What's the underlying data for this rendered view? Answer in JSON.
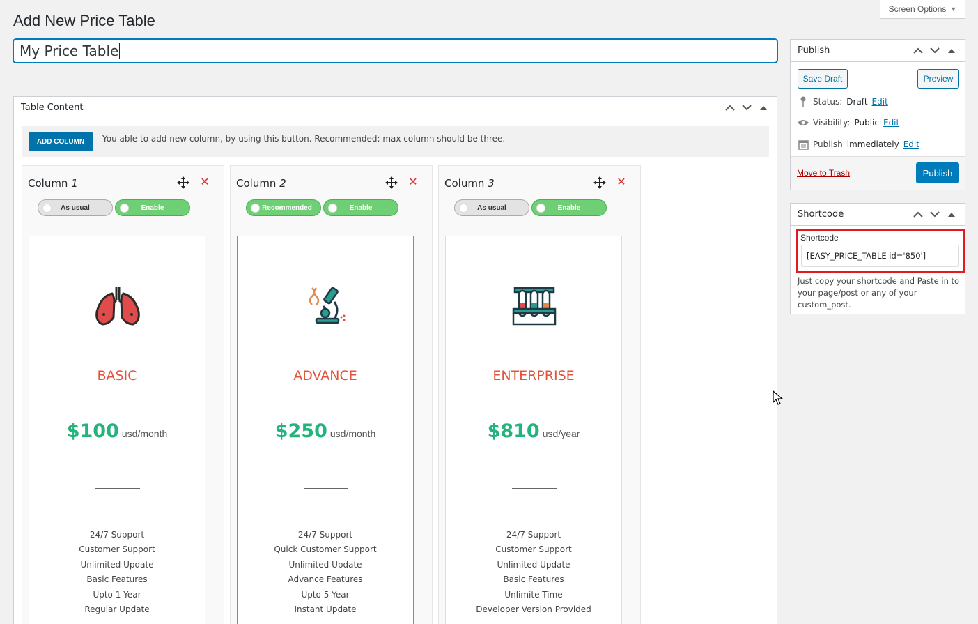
{
  "screen_options": {
    "label": "Screen Options"
  },
  "page": {
    "title": "Add New Price Table"
  },
  "title_field": {
    "value": "My Price Table"
  },
  "table_content": {
    "title": "Table Content",
    "add_column_label": "ADD COLUMN",
    "notice": "You able to add new column, by using this button. Recommended: max column should be three.",
    "columns": [
      {
        "label": "Column",
        "number": "1",
        "toggle_type": "As usual",
        "toggle_type_on": false,
        "toggle_status": "Enable",
        "name": "BASIC",
        "currency": "$",
        "price": "100",
        "unit": "usd/month",
        "icon": "lungs-icon",
        "featured": false,
        "features": [
          "24/7 Support",
          "Customer Support",
          "Unlimited Update",
          "Basic Features",
          "Upto 1 Year",
          "Regular Update"
        ]
      },
      {
        "label": "Column",
        "number": "2",
        "toggle_type": "Recommended",
        "toggle_type_on": true,
        "toggle_status": "Enable",
        "name": "ADVANCE",
        "currency": "$",
        "price": "250",
        "unit": "usd/month",
        "icon": "microscope-icon",
        "featured": true,
        "features": [
          "24/7 Support",
          "Quick Customer Support",
          "Unlimited Update",
          "Advance Features",
          "Upto 5 Year",
          "Instant Update"
        ]
      },
      {
        "label": "Column",
        "number": "3",
        "toggle_type": "As usual",
        "toggle_type_on": false,
        "toggle_status": "Enable",
        "name": "ENTERPRISE",
        "currency": "$",
        "price": "810",
        "unit": "usd/year",
        "icon": "test-tubes-icon",
        "featured": false,
        "features": [
          "24/7 Support",
          "Customer Support",
          "Unlimited Update",
          "Basic Features",
          "Unlimite Time",
          "Developer Version Provided"
        ]
      }
    ]
  },
  "publish": {
    "title": "Publish",
    "save_draft": "Save Draft",
    "preview": "Preview",
    "status_label": "Status:",
    "status_value": "Draft",
    "visibility_label": "Visibility:",
    "visibility_value": "Public",
    "schedule_label": "Publish",
    "schedule_value": "immediately",
    "edit_link": "Edit",
    "move_to_trash": "Move to Trash",
    "publish_button": "Publish"
  },
  "shortcode": {
    "title": "Shortcode",
    "label": "Shortcode",
    "value": "[EASY_PRICE_TABLE id='850']",
    "help": "Just copy your shortcode and Paste in to your page/post or any of your custom_post."
  },
  "colors": {
    "primary": "#007cba",
    "accent_name": "#e2543c",
    "price": "#23b47e",
    "enable_toggle": "#6fcf75",
    "delete": "#dc3232",
    "highlight": "#e21b22"
  }
}
